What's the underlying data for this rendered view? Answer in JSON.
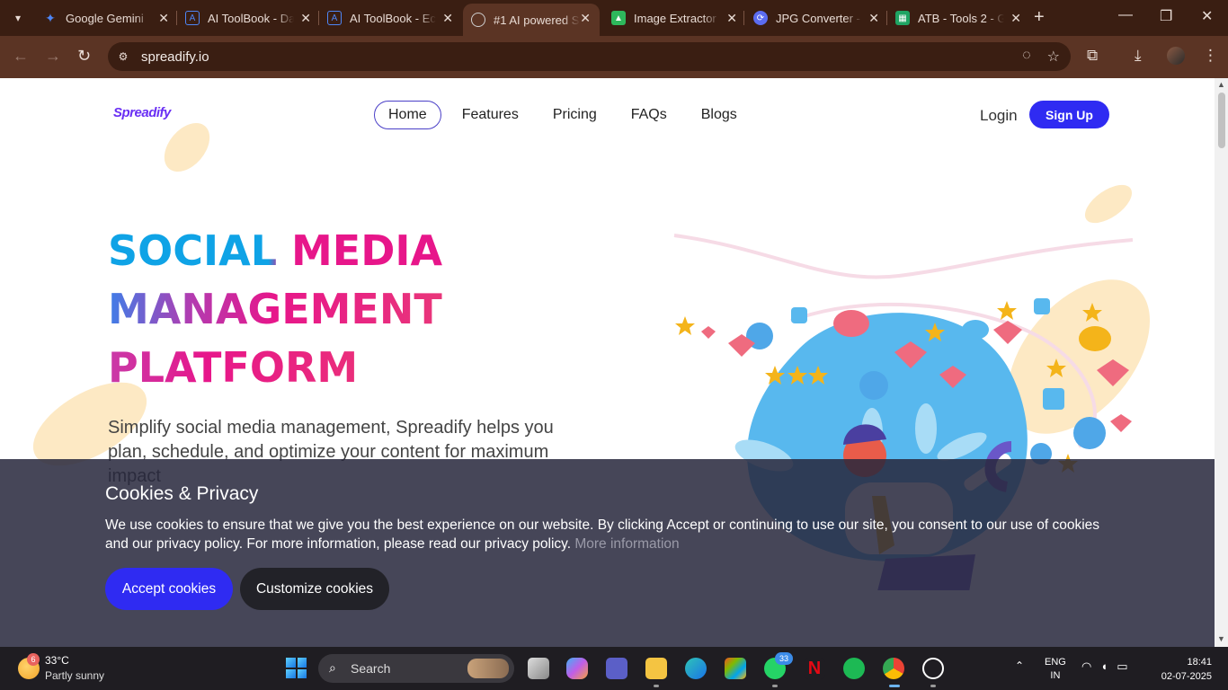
{
  "browser": {
    "tabs": [
      {
        "label": "Google Gemini",
        "icon": "gemini-icon",
        "color": "#4e86f6"
      },
      {
        "label": "AI ToolBook - Da",
        "icon": "aitoolbook-icon",
        "color": "#4e86f6"
      },
      {
        "label": "AI ToolBook - Ec",
        "icon": "aitoolbook-icon",
        "color": "#4e86f6"
      },
      {
        "label": "#1 AI powered S",
        "icon": "globe-icon",
        "color": "#cfcfcf"
      },
      {
        "label": "Image Extractor",
        "icon": "image-icon",
        "color": "#2eb85c"
      },
      {
        "label": "JPG Converter -",
        "icon": "converter-icon",
        "color": "#5b6cf0"
      },
      {
        "label": "ATB - Tools 2 - G",
        "icon": "sheets-icon",
        "color": "#1fa463"
      }
    ],
    "url": "spreadify.io"
  },
  "site": {
    "logo": "Spreadify",
    "nav": [
      "Home",
      "Features",
      "Pricing",
      "FAQs",
      "Blogs"
    ],
    "login": "Login",
    "signup": "Sign Up",
    "hero_line1": "SOCIAL MEDIA",
    "hero_line2": "MANAGEMENT",
    "hero_line3": "PLATFORM",
    "hero_sub": "Simplify social media management, Spreadify helps you plan, schedule, and optimize your content for maximum impact"
  },
  "cookies": {
    "title": "Cookies & Privacy",
    "text": "We use cookies to ensure that we give you the best experience on our website. By clicking Accept or continuing to use our site, you consent to our use of cookies and our privacy policy. For more information, please read our privacy policy.",
    "more": "More information",
    "accept": "Accept cookies",
    "customize": "Customize cookies"
  },
  "taskbar": {
    "weather_badge": "6",
    "temp": "33°C",
    "weather": "Partly sunny",
    "search": "Search",
    "whatsapp_badge": "33",
    "lang1": "ENG",
    "lang2": "IN",
    "time": "18:41",
    "date": "02-07-2025"
  }
}
